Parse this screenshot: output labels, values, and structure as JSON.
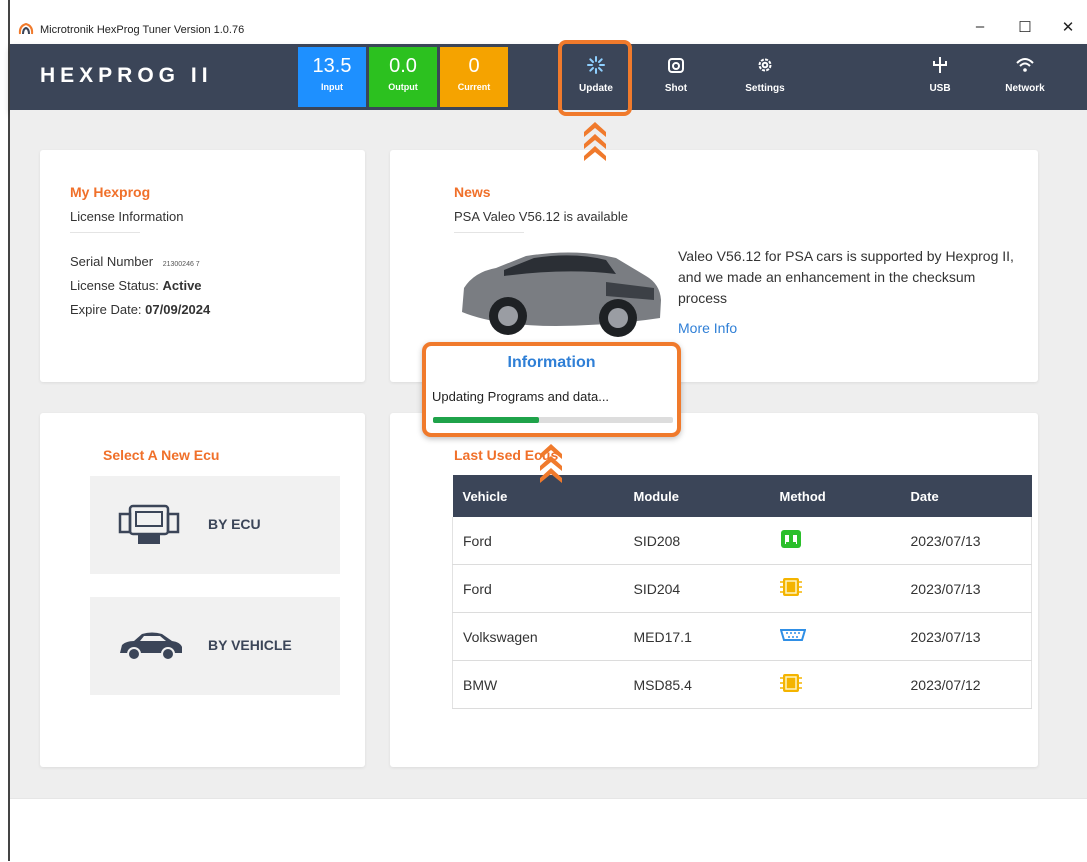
{
  "window": {
    "title": "Microtronik HexProg Tuner Version 1.0.76",
    "minimize": "–",
    "maximize": "☐",
    "close": "✕"
  },
  "header": {
    "brand": "HEXPROG II",
    "meters": [
      {
        "value": "13.5",
        "label": "Input",
        "color": "#1e90ff"
      },
      {
        "value": "0.0",
        "label": "Output",
        "color": "#2cc11f"
      },
      {
        "value": "0",
        "label": "Current",
        "color": "#f5a300"
      }
    ],
    "tools": [
      {
        "label": "Update",
        "icon": "spinner-icon"
      },
      {
        "label": "Shot",
        "icon": "camera-icon"
      },
      {
        "label": "Settings",
        "icon": "gear-icon"
      },
      {
        "label": "USB",
        "icon": "usb-icon"
      },
      {
        "label": "Network",
        "icon": "wifi-icon"
      }
    ]
  },
  "my_hexprog": {
    "title": "My Hexprog",
    "subtitle": "License Information",
    "serial_label": "Serial Number",
    "serial_value": "21300246 7",
    "status_label": "License Status:",
    "status_value": "Active",
    "expire_label": "Expire Date:",
    "expire_value": "07/09/2024"
  },
  "news": {
    "title": "News",
    "headline": "PSA Valeo V56.12 is available",
    "body": "Valeo V56.12 for PSA cars is supported by Hexprog II, and we made an enhancement in the checksum process",
    "more": "More Info"
  },
  "dialog": {
    "title": "Information",
    "message": "Updating Programs and data...",
    "progress": 0.44
  },
  "select_ecu": {
    "title": "Select A New Ecu",
    "by_ecu": "BY ECU",
    "by_vehicle": "BY VEHICLE"
  },
  "last_used": {
    "title": "Last Used Ecus",
    "columns": [
      "Vehicle",
      "Module",
      "Method",
      "Date"
    ],
    "rows": [
      {
        "vehicle": "Ford",
        "module": "SID208",
        "method": "obd-connector-icon",
        "date": "2023/07/13"
      },
      {
        "vehicle": "Ford",
        "module": "SID204",
        "method": "chip-icon",
        "date": "2023/07/13"
      },
      {
        "vehicle": "Volkswagen",
        "module": "MED17.1",
        "method": "bench-connector-icon",
        "date": "2023/07/13"
      },
      {
        "vehicle": "BMW",
        "module": "MSD85.4",
        "method": "chip-icon",
        "date": "2023/07/12"
      }
    ]
  },
  "colors": {
    "accent": "#f07a2c",
    "header": "#3b4558",
    "link": "#2f7fd6"
  }
}
